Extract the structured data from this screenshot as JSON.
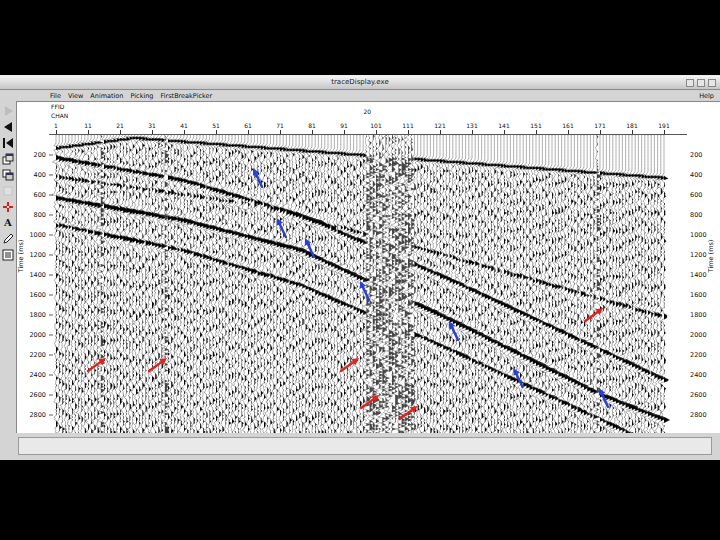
{
  "window": {
    "title": "traceDisplay.exe"
  },
  "menu": [
    {
      "label": "File"
    },
    {
      "label": "View"
    },
    {
      "label": "Animation"
    },
    {
      "label": "Picking"
    },
    {
      "label": "FirstBreakPicker"
    }
  ],
  "help_menu": {
    "label": "Help"
  },
  "toolbar": [
    {
      "kind": "play",
      "disabled": true
    },
    {
      "kind": "back",
      "disabled": false
    },
    {
      "kind": "back-bar",
      "disabled": false
    },
    {
      "kind": "windows",
      "disabled": false
    },
    {
      "kind": "windows2",
      "disabled": false
    },
    {
      "kind": "blank",
      "disabled": true
    },
    {
      "kind": "move",
      "disabled": false
    },
    {
      "kind": "text",
      "label": "A",
      "disabled": false
    },
    {
      "kind": "pencil",
      "disabled": false
    },
    {
      "kind": "lines",
      "disabled": false
    }
  ],
  "plot": {
    "header_labels": [
      "FFID",
      "CHAN"
    ],
    "ffid": {
      "label": "20",
      "channel": 98
    },
    "channels": [
      {
        "label": "1",
        "channel": 1
      },
      {
        "label": "11",
        "channel": 11
      },
      {
        "label": "21",
        "channel": 21
      },
      {
        "label": "31",
        "channel": 31
      },
      {
        "label": "41",
        "channel": 41
      },
      {
        "label": "51",
        "channel": 51
      },
      {
        "label": "61",
        "channel": 61
      },
      {
        "label": "71",
        "channel": 71
      },
      {
        "label": "81",
        "channel": 81
      },
      {
        "label": "91",
        "channel": 91
      },
      {
        "label": "101",
        "channel": 101
      },
      {
        "label": "111",
        "channel": 111
      },
      {
        "label": "121",
        "channel": 121
      },
      {
        "label": "131",
        "channel": 131
      },
      {
        "label": "141",
        "channel": 141
      },
      {
        "label": "151",
        "channel": 151
      },
      {
        "label": "161",
        "channel": 161
      },
      {
        "label": "171",
        "channel": 171
      },
      {
        "label": "181",
        "channel": 181
      },
      {
        "label": "191",
        "channel": 191
      }
    ],
    "channel_count": 191,
    "time_axis": {
      "label": "Time (ms)",
      "max": 3000,
      "ticks": [
        {
          "label": "200",
          "time": 200
        },
        {
          "label": "400",
          "time": 400
        },
        {
          "label": "600",
          "time": 600
        },
        {
          "label": "800",
          "time": 800
        },
        {
          "label": "1000",
          "time": 1000
        },
        {
          "label": "1200",
          "time": 1200
        },
        {
          "label": "1400",
          "time": 1400
        },
        {
          "label": "1600",
          "time": 1600
        },
        {
          "label": "1800",
          "time": 1800
        },
        {
          "label": "2000",
          "time": 2000
        },
        {
          "label": "2200",
          "time": 2200
        },
        {
          "label": "2400",
          "time": 2400
        },
        {
          "label": "2600",
          "time": 2600
        },
        {
          "label": "2800",
          "time": 2800
        }
      ]
    },
    "first_break": {
      "points": [
        [
          1,
          130
        ],
        [
          25,
          30
        ],
        [
          191,
          430
        ]
      ],
      "amplitude": 0.9
    },
    "events": [
      {
        "points": [
          [
            1,
            230
          ],
          [
            40,
            450
          ],
          [
            77,
            800
          ],
          [
            124,
            1450
          ],
          [
            171,
            2150
          ],
          [
            191,
            2450
          ]
        ],
        "amplitude": 0.8
      },
      {
        "points": [
          [
            1,
            420
          ],
          [
            60,
            680
          ],
          [
            120,
            1180
          ],
          [
            191,
            1820
          ]
        ],
        "amplitude": 0.45
      },
      {
        "points": [
          [
            1,
            630
          ],
          [
            40,
            850
          ],
          [
            77,
            1150
          ],
          [
            124,
            1850
          ],
          [
            171,
            2600
          ],
          [
            191,
            2850
          ]
        ],
        "amplitude": 1.0
      },
      {
        "points": [
          [
            1,
            900
          ],
          [
            40,
            1150
          ],
          [
            77,
            1500
          ],
          [
            124,
            2150
          ],
          [
            171,
            2850
          ]
        ],
        "amplitude": 0.7
      }
    ],
    "noise_traces": [
      15,
      35,
      98,
      99,
      100,
      101,
      102,
      103,
      104,
      105,
      106,
      107,
      108,
      109,
      110,
      111,
      112,
      170
    ],
    "arrows": [
      {
        "kind": "reflection",
        "channel": 62.6,
        "time": 330,
        "color": "#2a3fd6"
      },
      {
        "kind": "reflection",
        "channel": 70,
        "time": 830,
        "color": "#2a3fd6"
      },
      {
        "kind": "reflection",
        "channel": 78.8,
        "time": 1030,
        "color": "#2a3fd6"
      },
      {
        "kind": "reflection",
        "channel": 96,
        "time": 1460,
        "color": "#2a3fd6"
      },
      {
        "kind": "reflection",
        "channel": 123.8,
        "time": 1860,
        "color": "#2a3fd6"
      },
      {
        "kind": "reflection",
        "channel": 144,
        "time": 2330,
        "color": "#2a3fd6"
      },
      {
        "kind": "reflection",
        "channel": 170.7,
        "time": 2530,
        "color": "#2a3fd6"
      },
      {
        "kind": "noise",
        "channel": 16.6,
        "time": 2230,
        "color": "#e3221c"
      },
      {
        "kind": "noise",
        "channel": 35.7,
        "time": 2230,
        "color": "#e3221c"
      },
      {
        "kind": "noise",
        "channel": 95.7,
        "time": 2230,
        "color": "#e3221c"
      },
      {
        "kind": "noise",
        "channel": 102,
        "time": 2600,
        "color": "#e3221c"
      },
      {
        "kind": "noise",
        "channel": 114,
        "time": 2710,
        "color": "#e3221c"
      },
      {
        "kind": "noise",
        "channel": 172,
        "time": 1730,
        "color": "#e3221c"
      }
    ]
  }
}
